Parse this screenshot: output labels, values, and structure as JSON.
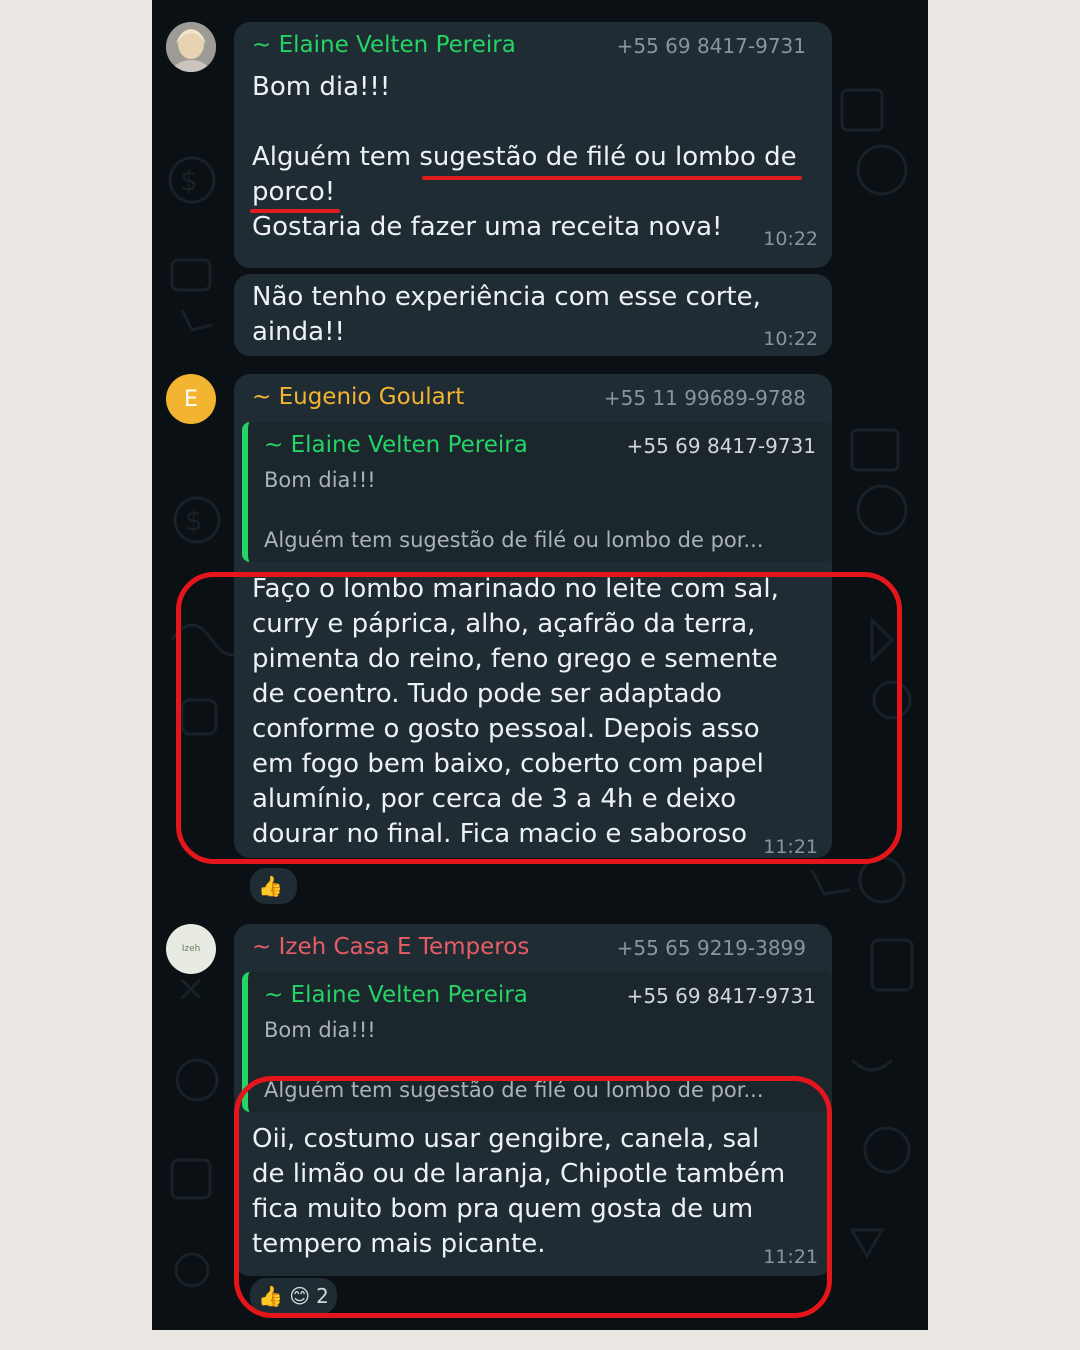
{
  "colors": {
    "chat_background": "#0b1014",
    "bubble": "#202c33",
    "quote_bar": "#25d366",
    "name_elaine": "#25d366",
    "name_eugenio": "#f2b431",
    "name_izeh": "#e85c66",
    "annotation_red": "#e4161b"
  },
  "messages": [
    {
      "sender": "~ Elaine Velten Pereira",
      "phone": "+55 69 8417-9731",
      "text": "Bom dia!!!\n\nAlguém tem sugestão de filé ou lombo de porco!\nGostaria de fazer uma receita nova!",
      "time": "10:22"
    },
    {
      "text": "Não tenho experiência com esse corte, ainda!!",
      "time": "10:22"
    },
    {
      "avatar_initial": "E",
      "sender": "~ Eugenio Goulart",
      "phone": "+55 11 99689-9788",
      "quote": {
        "sender": "~ Elaine Velten Pereira",
        "phone": "+55 69 8417-9731",
        "line1": "Bom dia!!!",
        "line2": "Alguém tem sugestão de filé ou lombo de por..."
      },
      "text": "Faço o lombo marinado no leite com sal, curry e páprica, alho, açafrão da terra, pimenta do reino, feno grego e semente de coentro. Tudo pode ser adaptado conforme o gosto pessoal. Depois asso em fogo bem baixo, coberto com papel alumínio, por cerca de 3 a 4h e deixo dourar no final. Fica macio e saboroso",
      "time": "11:21",
      "reactions": {
        "emoji": "👍",
        "count": ""
      }
    },
    {
      "avatar_text": "Izeh",
      "sender": "~ Izeh Casa E Temperos",
      "phone": "+55 65 9219-3899",
      "quote": {
        "sender": "~ Elaine Velten Pereira",
        "phone": "+55 69 8417-9731",
        "line1": "Bom dia!!!",
        "line2": "Alguém tem sugestão de filé ou lombo de por..."
      },
      "text": "Oii, costumo usar gengibre, canela, sal de limão ou de laranja, Chipotle também fica muito bom pra quem gosta de um tempero mais picante.",
      "time": "11:21",
      "reactions": {
        "emoji": "👍 😊",
        "count": "2"
      }
    }
  ]
}
